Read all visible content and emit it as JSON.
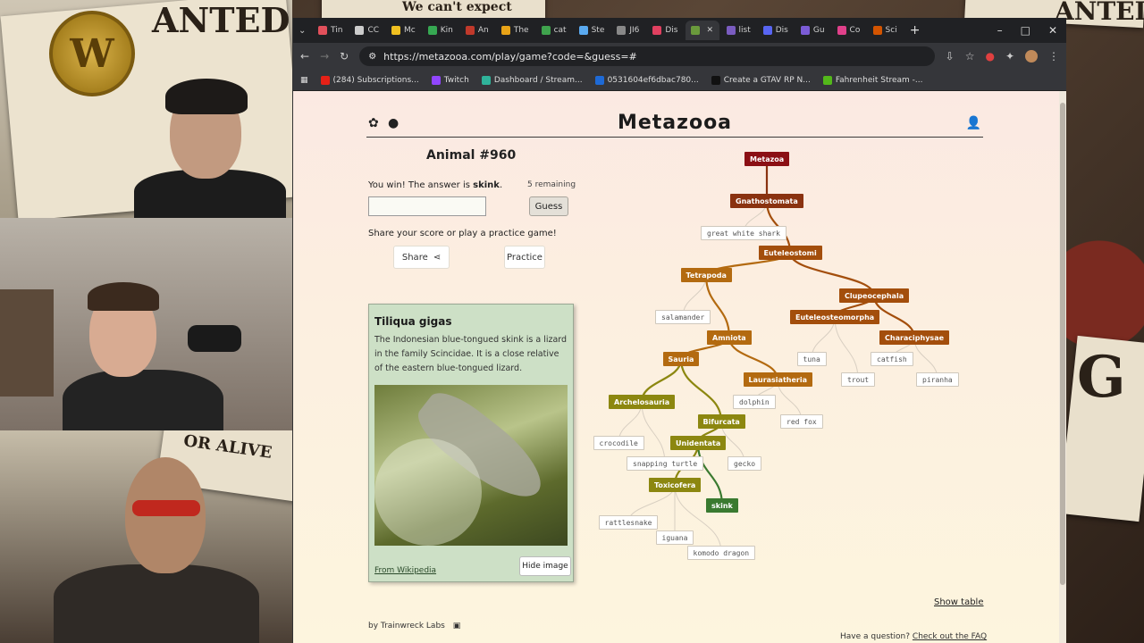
{
  "browser": {
    "tabs": [
      {
        "label": "Tin",
        "color": "#e2505b"
      },
      {
        "label": "CC",
        "color": "#cccccc"
      },
      {
        "label": "Mc",
        "color": "#f0c020"
      },
      {
        "label": "Kin",
        "color": "#36a852"
      },
      {
        "label": "An",
        "color": "#c0392b"
      },
      {
        "label": "The",
        "color": "#e8a317"
      },
      {
        "label": "cat",
        "color": "#3fa34d"
      },
      {
        "label": "Ste",
        "color": "#5aaaf0"
      },
      {
        "label": "JI6",
        "color": "#888888"
      },
      {
        "label": "Dis",
        "color": "#e04060"
      },
      {
        "label": "",
        "color": "#6a9a3c"
      },
      {
        "label": "list",
        "color": "#7a5cc0"
      },
      {
        "label": "Dis",
        "color": "#5865f2"
      },
      {
        "label": "Gu",
        "color": "#7b5cd6"
      },
      {
        "label": "Co",
        "color": "#e0408a"
      },
      {
        "label": "Sci",
        "color": "#d35400"
      }
    ],
    "url": "https://metazooa.com/play/game?code=&guess=#",
    "bookmarks": [
      {
        "label": "(284) Subscriptions...",
        "color": "#e62117"
      },
      {
        "label": "Twitch",
        "color": "#9146ff"
      },
      {
        "label": "Dashboard / Stream...",
        "color": "#2fb39a"
      },
      {
        "label": "0531604ef6dbac780...",
        "color": "#1e6ad6"
      },
      {
        "label": "Create a GTAV RP N...",
        "color": "#111111"
      },
      {
        "label": "Fahrenheit Stream -...",
        "color": "#53b81a"
      }
    ]
  },
  "stream": {
    "poster_top": "ANTED",
    "poster_top2": "We can't expect",
    "poster_mid": "OR ALIVE",
    "poster_right": "ANTED",
    "badge": "W",
    "poster_right_letter": "G"
  },
  "game": {
    "site_title": "Metazooa",
    "animal_number": "Animal #960",
    "win_prefix": "You win! The answer is ",
    "answer": "skink",
    "win_suffix": ".",
    "remaining": "5 remaining",
    "guess_button": "Guess",
    "guess_value": "",
    "share_message": "Share your score or play a practice game!",
    "share_button": "Share",
    "practice_button": "Practice",
    "show_table": "Show table",
    "footer_by": "by Trainwreck Labs",
    "footer_question": "Have a question? ",
    "footer_faq": "Check out the FAQ"
  },
  "card": {
    "title": "Tiliqua gigas",
    "description": "The Indonesian blue-tongued skink is a lizard in the family Scincidae. It is a close relative of the eastern blue-tongued lizard.",
    "source_link": "From Wikipedia",
    "hide_button": "Hide image"
  },
  "tree": {
    "colors": {
      "root": "#8b0f14",
      "deep": "#8a3210",
      "mid": "#a34e0c",
      "warm": "#b36a10",
      "olive": "#8c8710",
      "green": "#3a7a30"
    },
    "nodes": [
      {
        "id": "metazoa",
        "label": "Metazoa",
        "kind": "clade",
        "tone": "root"
      },
      {
        "id": "gnathostomata",
        "label": "Gnathostomata",
        "kind": "clade",
        "tone": "deep"
      },
      {
        "id": "great-white-shark",
        "label": "great white shark",
        "kind": "leaf"
      },
      {
        "id": "euteleostomi",
        "label": "Euteleostomi",
        "kind": "clade",
        "tone": "mid"
      },
      {
        "id": "tetrapoda",
        "label": "Tetrapoda",
        "kind": "clade",
        "tone": "warm"
      },
      {
        "id": "clupeocephala",
        "label": "Clupeocephala",
        "kind": "clade",
        "tone": "mid"
      },
      {
        "id": "salamander",
        "label": "salamander",
        "kind": "leaf"
      },
      {
        "id": "euteleosteomorpha",
        "label": "Euteleosteomorpha",
        "kind": "clade",
        "tone": "mid"
      },
      {
        "id": "amniota",
        "label": "Amniota",
        "kind": "clade",
        "tone": "warm"
      },
      {
        "id": "characiphysae",
        "label": "Characiphysae",
        "kind": "clade",
        "tone": "mid"
      },
      {
        "id": "sauria",
        "label": "Sauria",
        "kind": "clade",
        "tone": "warm"
      },
      {
        "id": "tuna",
        "label": "tuna",
        "kind": "leaf"
      },
      {
        "id": "catfish",
        "label": "catfish",
        "kind": "leaf"
      },
      {
        "id": "laurasiatheria",
        "label": "Laurasiatheria",
        "kind": "clade",
        "tone": "warm"
      },
      {
        "id": "trout",
        "label": "trout",
        "kind": "leaf"
      },
      {
        "id": "piranha",
        "label": "piranha",
        "kind": "leaf"
      },
      {
        "id": "archelosauria",
        "label": "Archelosauria",
        "kind": "clade",
        "tone": "olive"
      },
      {
        "id": "dolphin",
        "label": "dolphin",
        "kind": "leaf"
      },
      {
        "id": "bifurcata",
        "label": "Bifurcata",
        "kind": "clade",
        "tone": "olive"
      },
      {
        "id": "red-fox",
        "label": "red fox",
        "kind": "leaf"
      },
      {
        "id": "crocodile",
        "label": "crocodile",
        "kind": "leaf"
      },
      {
        "id": "unidentata",
        "label": "Unidentata",
        "kind": "clade",
        "tone": "olive"
      },
      {
        "id": "snapping-turtle",
        "label": "snapping turtle",
        "kind": "leaf"
      },
      {
        "id": "gecko",
        "label": "gecko",
        "kind": "leaf"
      },
      {
        "id": "toxicofera",
        "label": "Toxicofera",
        "kind": "clade",
        "tone": "olive"
      },
      {
        "id": "skink",
        "label": "skink",
        "kind": "clade",
        "tone": "green"
      },
      {
        "id": "rattlesnake",
        "label": "rattlesnake",
        "kind": "leaf"
      },
      {
        "id": "iguana",
        "label": "iguana",
        "kind": "leaf"
      },
      {
        "id": "komodo-dragon",
        "label": "komodo dragon",
        "kind": "leaf"
      }
    ],
    "edges": [
      [
        "metazoa",
        "gnathostomata"
      ],
      [
        "gnathostomata",
        "great-white-shark"
      ],
      [
        "gnathostomata",
        "euteleostomi"
      ],
      [
        "euteleostomi",
        "tetrapoda"
      ],
      [
        "euteleostomi",
        "clupeocephala"
      ],
      [
        "tetrapoda",
        "salamander"
      ],
      [
        "tetrapoda",
        "amniota"
      ],
      [
        "clupeocephala",
        "euteleosteomorpha"
      ],
      [
        "clupeocephala",
        "characiphysae"
      ],
      [
        "euteleosteomorpha",
        "tuna"
      ],
      [
        "euteleosteomorpha",
        "trout"
      ],
      [
        "characiphysae",
        "catfish"
      ],
      [
        "characiphysae",
        "piranha"
      ],
      [
        "amniota",
        "sauria"
      ],
      [
        "amniota",
        "laurasiatheria"
      ],
      [
        "laurasiatheria",
        "dolphin"
      ],
      [
        "laurasiatheria",
        "red-fox"
      ],
      [
        "sauria",
        "archelosauria"
      ],
      [
        "sauria",
        "bifurcata"
      ],
      [
        "archelosauria",
        "crocodile"
      ],
      [
        "archelosauria",
        "snapping-turtle"
      ],
      [
        "bifurcata",
        "unidentata"
      ],
      [
        "bifurcata",
        "gecko"
      ],
      [
        "unidentata",
        "toxicofera"
      ],
      [
        "unidentata",
        "skink"
      ],
      [
        "toxicofera",
        "rattlesnake"
      ],
      [
        "toxicofera",
        "iguana"
      ],
      [
        "toxicofera",
        "komodo-dragon"
      ]
    ]
  }
}
